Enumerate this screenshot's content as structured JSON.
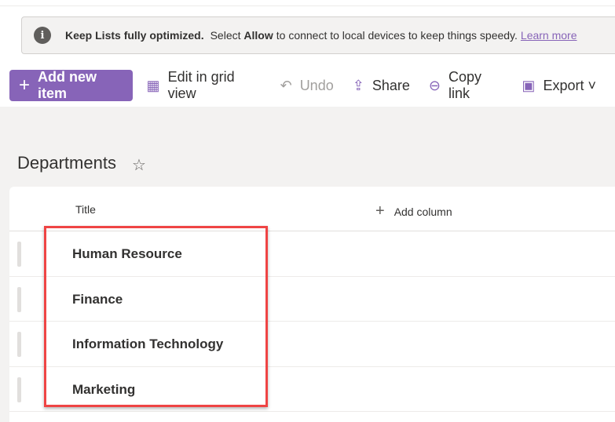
{
  "banner": {
    "bold": "Keep Lists fully optimized.",
    "pre": "Select",
    "allow": "Allow",
    "post": "to connect to local devices to keep things speedy.",
    "link": "Learn more"
  },
  "toolbar": {
    "add": "Add new item",
    "grid": "Edit in grid view",
    "undo": "Undo",
    "share": "Share",
    "copy": "Copy link",
    "export": "Export"
  },
  "list": {
    "title": "Departments",
    "column": "Title",
    "add_column": "Add column",
    "rows": [
      "Human Resource",
      "Finance",
      "Information Technology",
      "Marketing"
    ]
  },
  "colors": {
    "accent": "#8764b8",
    "highlight": "#ef4444"
  }
}
